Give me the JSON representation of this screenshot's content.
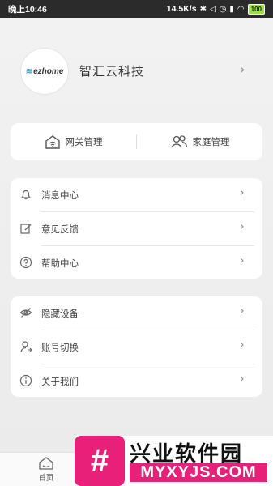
{
  "status_bar": {
    "time": "晚上10:46",
    "speed": "14.5K/s",
    "battery": "100"
  },
  "profile": {
    "logo_text": "ezhome",
    "company_name": "智汇云科技"
  },
  "top_card": {
    "gateway_label": "网关管理",
    "family_label": "家庭管理"
  },
  "menu_group_1": [
    {
      "label": "消息中心",
      "icon": "bell-icon"
    },
    {
      "label": "意见反馈",
      "icon": "edit-icon"
    },
    {
      "label": "帮助中心",
      "icon": "help-icon"
    }
  ],
  "menu_group_2": [
    {
      "label": "隐藏设备",
      "icon": "eye-off-icon"
    },
    {
      "label": "账号切换",
      "icon": "user-switch-icon"
    },
    {
      "label": "关于我们",
      "icon": "info-icon"
    }
  ],
  "tabbar": {
    "home_label": "首页"
  },
  "watermark": {
    "title": "兴业软件园",
    "subtitle": "MYXYJS.COM",
    "badge": "#"
  }
}
